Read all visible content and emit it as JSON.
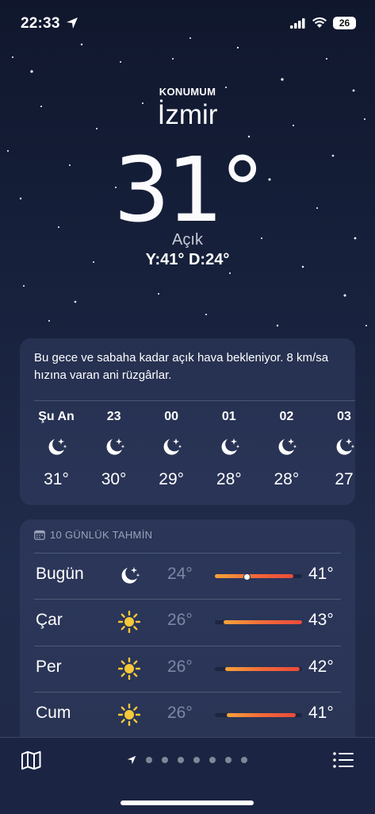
{
  "status_bar": {
    "time": "22:33",
    "battery": "26"
  },
  "location": {
    "label": "KONUMUM",
    "city": "İzmir"
  },
  "current": {
    "temp": "31°",
    "condition": "Açık",
    "hilo": "Y:41° D:24°"
  },
  "hourly": {
    "summary": "Bu gece ve sabaha kadar açık hava bekleniyor. 8 km/sa hızına varan ani rüzgârlar.",
    "hours": [
      {
        "label": "Şu An",
        "icon": "moon-stars-icon",
        "temp": "31°"
      },
      {
        "label": "23",
        "icon": "moon-stars-icon",
        "temp": "30°"
      },
      {
        "label": "00",
        "icon": "moon-stars-icon",
        "temp": "29°"
      },
      {
        "label": "01",
        "icon": "moon-stars-icon",
        "temp": "28°"
      },
      {
        "label": "02",
        "icon": "moon-stars-icon",
        "temp": "28°"
      },
      {
        "label": "03",
        "icon": "moon-stars-icon",
        "temp": "27"
      }
    ]
  },
  "daily": {
    "header": "10 GÜNLÜK TAHMİN",
    "days": [
      {
        "name": "Bugün",
        "icon": "moon-stars-icon",
        "low": "24°",
        "high": "41°",
        "range_start": 0.0,
        "range_end": 0.9,
        "current_marker": 0.36
      },
      {
        "name": "Çar",
        "icon": "sun-icon",
        "low": "26°",
        "high": "43°",
        "range_start": 0.1,
        "range_end": 1.0
      },
      {
        "name": "Per",
        "icon": "sun-icon",
        "low": "26°",
        "high": "42°",
        "range_start": 0.12,
        "range_end": 0.97
      },
      {
        "name": "Cum",
        "icon": "sun-icon",
        "low": "26°",
        "high": "41°",
        "range_start": 0.14,
        "range_end": 0.93
      }
    ]
  },
  "bottom_bar": {
    "page_count": 7,
    "active_page": 0
  },
  "colors": {
    "background_top": "#10172d",
    "background_bottom": "#212c4c",
    "accent_bar": "#f26a3a",
    "sun": "#f7c83a"
  }
}
